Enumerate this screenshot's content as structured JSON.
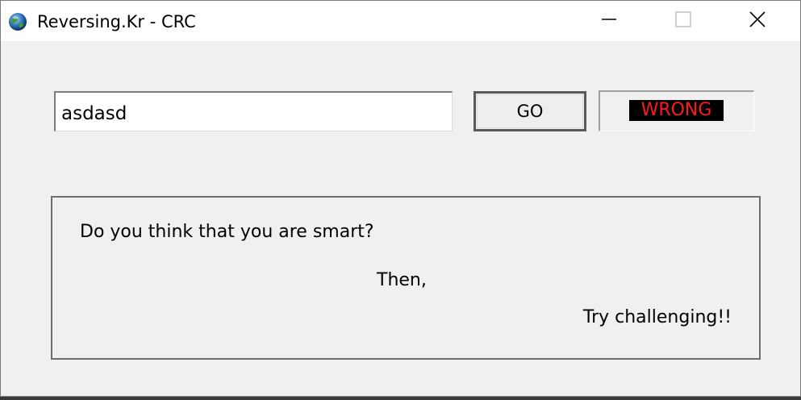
{
  "window": {
    "title": "Reversing.Kr - CRC",
    "icons": {
      "app": "globe-icon",
      "minimize": "minimize-icon",
      "maximize": "maximize-icon",
      "close": "close-icon"
    }
  },
  "form": {
    "input_value": "asdasd",
    "go_label": "GO",
    "result_text": "WRONG"
  },
  "colors": {
    "result_text": "#ff1a1a",
    "result_background": "#000000",
    "window_background": "#f0f0f0",
    "titlebar_background": "#ffffff"
  },
  "message": {
    "line1": "Do you think that you are smart?",
    "line2": "Then,",
    "line3": "Try challenging!!"
  }
}
